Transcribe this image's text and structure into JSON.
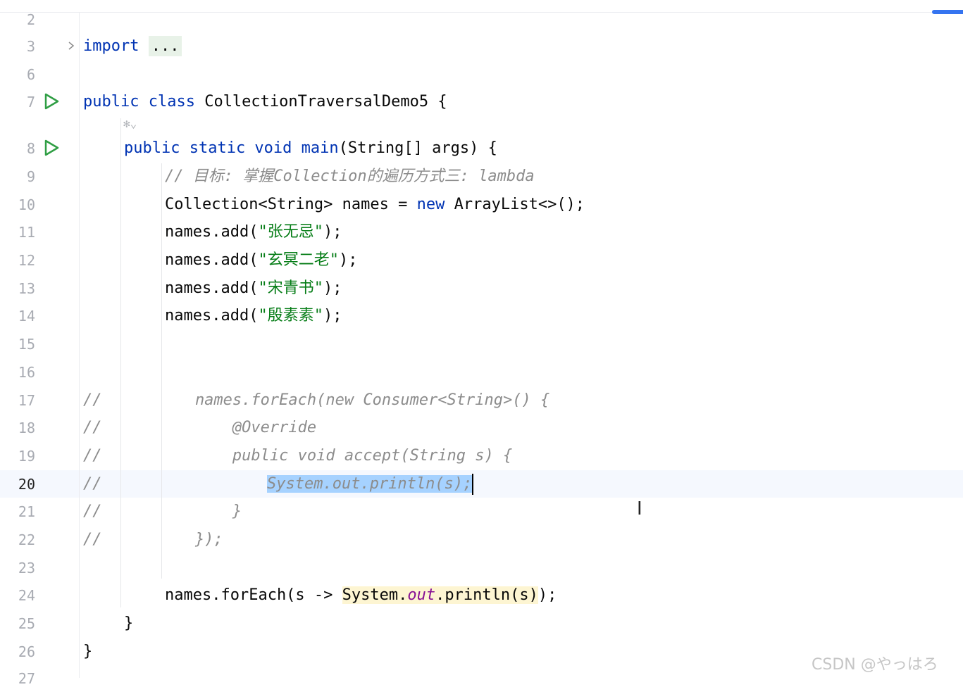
{
  "gutter": {
    "line_numbers": [
      "2",
      "3",
      "6",
      "7",
      "8",
      "9",
      "10",
      "11",
      "12",
      "13",
      "14",
      "15",
      "16",
      "17",
      "18",
      "19",
      "20",
      "21",
      "22",
      "23",
      "24",
      "25",
      "26",
      "27"
    ],
    "active_line": "20"
  },
  "code": {
    "import_kw": "import",
    "import_fold": "...",
    "class_mods": "public class",
    "class_decl": " CollectionTraversalDemo5 {",
    "main_mods": "public static void",
    "main_name": "main",
    "main_params": "(String[] args) {",
    "comment_goal": "// 目标: 掌握Collection的遍历方式三: lambda",
    "coll_decl": "Collection<String> names = ",
    "new_kw": "new",
    "coll_init": " ArrayList<>();",
    "add_prefix": "names.add(",
    "add_suffix": ");",
    "strings": [
      "\"张无忌\"",
      "\"玄冥二老\"",
      "\"宋青书\"",
      "\"殷素素\""
    ],
    "commented_block": [
      "//          names.forEach(new Consumer<String>() {",
      "//              @Override",
      "//              public void accept(String s) {",
      "//",
      "//              }",
      "//          });"
    ],
    "selected_text": "System.out.println(s);",
    "foreach_prefix": "names.forEach(s -> ",
    "foreach_system": "System.",
    "foreach_out": "out",
    "foreach_println": ".println(s)",
    "foreach_suffix": ");",
    "close_main": "}",
    "close_class": "}"
  },
  "watermark": "CSDN @やっはろ",
  "colors": {
    "keyword": "#0033b3",
    "comment": "#8c8c8c",
    "string": "#067d17",
    "field": "#871094",
    "selection": "#a6d2ff",
    "current_line": "#f5f8fe"
  }
}
